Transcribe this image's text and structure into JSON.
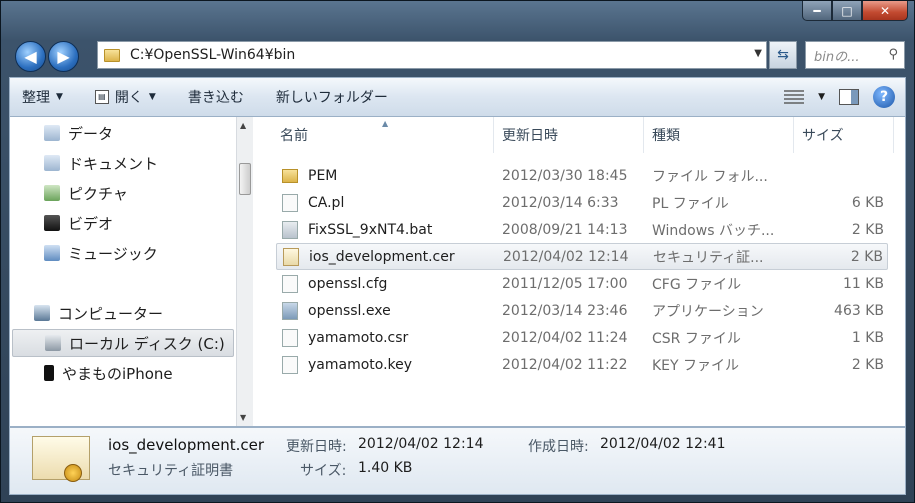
{
  "window": {
    "caption_minimize": "━",
    "caption_maximize": "□",
    "caption_close": "✕"
  },
  "address": {
    "path": "C:¥OpenSSL-Win64¥bin",
    "search_placeholder": "binの..."
  },
  "toolbar": {
    "organize": "整理",
    "open": "開く",
    "burn": "書き込む",
    "new_folder": "新しいフォルダー"
  },
  "nav_pane": {
    "items": [
      {
        "label": "データ",
        "icon": "document-icon"
      },
      {
        "label": "ドキュメント",
        "icon": "document-icon"
      },
      {
        "label": "ピクチャ",
        "icon": "picture-icon"
      },
      {
        "label": "ビデオ",
        "icon": "video-icon"
      },
      {
        "label": "ミュージック",
        "icon": "music-icon"
      },
      {
        "label": "コンピューター",
        "icon": "computer-icon"
      },
      {
        "label": "ローカル ディスク (C:)",
        "icon": "disk-icon"
      },
      {
        "label": "やまものiPhone",
        "icon": "phone-icon"
      }
    ]
  },
  "columns": {
    "name": "名前",
    "date": "更新日時",
    "type": "種類",
    "size": "サイズ"
  },
  "files": [
    {
      "name": "PEM",
      "date": "2012/03/30 18:45",
      "type": "ファイル フォル...",
      "size": "",
      "icon": "folder"
    },
    {
      "name": "CA.pl",
      "date": "2012/03/14 6:33",
      "type": "PL ファイル",
      "size": "6 KB",
      "icon": "doc"
    },
    {
      "name": "FixSSL_9xNT4.bat",
      "date": "2008/09/21 14:13",
      "type": "Windows バッチ...",
      "size": "2 KB",
      "icon": "bat"
    },
    {
      "name": "ios_development.cer",
      "date": "2012/04/02 12:14",
      "type": "セキュリティ証...",
      "size": "2 KB",
      "icon": "cert"
    },
    {
      "name": "openssl.cfg",
      "date": "2011/12/05 17:00",
      "type": "CFG ファイル",
      "size": "11 KB",
      "icon": "doc"
    },
    {
      "name": "openssl.exe",
      "date": "2012/03/14 23:46",
      "type": "アプリケーション",
      "size": "463 KB",
      "icon": "exe"
    },
    {
      "name": "yamamoto.csr",
      "date": "2012/04/02 11:24",
      "type": "CSR ファイル",
      "size": "1 KB",
      "icon": "doc"
    },
    {
      "name": "yamamoto.key",
      "date": "2012/04/02 11:22",
      "type": "KEY ファイル",
      "size": "2 KB",
      "icon": "doc"
    }
  ],
  "details": {
    "name": "ios_development.cer",
    "type": "セキュリティ証明書",
    "modified_label": "更新日時:",
    "modified_value": "2012/04/02 12:14",
    "created_label": "作成日時:",
    "created_value": "2012/04/02 12:41",
    "size_label": "サイズ:",
    "size_value": "1.40 KB"
  }
}
